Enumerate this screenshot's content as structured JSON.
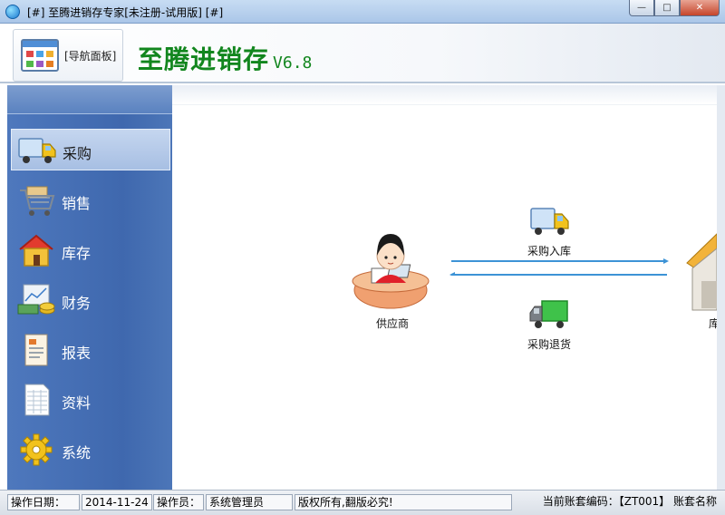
{
  "window": {
    "title": "[#] 至腾进销存专家[未注册-试用版] [#]",
    "controls": {
      "minimize": "—",
      "maximize": "□",
      "close": "✕"
    }
  },
  "header": {
    "nav_panel_label": "[导航面板]",
    "brand_name": "至腾进销存",
    "brand_version": "V6.8"
  },
  "sidebar": {
    "items": [
      {
        "label": "采购",
        "icon": "truck-icon",
        "active": true
      },
      {
        "label": "销售",
        "icon": "shopping-cart-icon",
        "active": false
      },
      {
        "label": "库存",
        "icon": "house-icon",
        "active": false
      },
      {
        "label": "财务",
        "icon": "money-chart-icon",
        "active": false
      },
      {
        "label": "报表",
        "icon": "report-icon",
        "active": false
      },
      {
        "label": "资料",
        "icon": "spreadsheet-icon",
        "active": false
      },
      {
        "label": "系统",
        "icon": "gear-icon",
        "active": false
      }
    ]
  },
  "diagram": {
    "supplier_label": "供应商",
    "purchase_in_label": "采购入库",
    "purchase_return_label": "采购退货",
    "warehouse_label_partial": "库"
  },
  "status": {
    "date_label": "操作日期：",
    "date_value": "2014-11-24",
    "operator_label": "操作员：",
    "operator_value": "系统管理员",
    "copyright": "版权所有,翻版必究!",
    "account_code_text": "当前账套编码：【ZT001】 账套名称"
  },
  "colors": {
    "brand_green": "#12861e",
    "sidebar_blue": "#3f68ae",
    "arrow_blue": "#3d93d6"
  }
}
